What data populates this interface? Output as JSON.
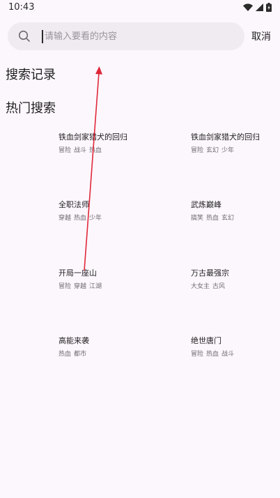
{
  "status_bar": {
    "time": "10:43",
    "icons": [
      "wifi-icon",
      "signal-icon",
      "battery-icon"
    ]
  },
  "search": {
    "placeholder": "请输入要看的内容",
    "value": "",
    "cancel_label": "取消"
  },
  "sections": {
    "history_title": "搜索记录",
    "hot_title": "热门搜索"
  },
  "hot_items": [
    {
      "title": "铁血剑家猎犬的回归",
      "tags": [
        "冒险",
        "战斗",
        "热血"
      ]
    },
    {
      "title": "铁血剑家猎犬的回归",
      "tags": [
        "冒险",
        "玄幻",
        "少年"
      ]
    },
    {
      "title": "全职法师",
      "tags": [
        "穿越",
        "热血",
        "少年"
      ]
    },
    {
      "title": "武炼巅峰",
      "tags": [
        "搞笑",
        "热血",
        "玄幻"
      ]
    },
    {
      "title": "开局一座山",
      "tags": [
        "冒险",
        "穿越",
        "江湖"
      ]
    },
    {
      "title": "万古最强宗",
      "tags": [
        "大女主",
        "古风"
      ]
    },
    {
      "title": "高能来袭",
      "tags": [
        "热血",
        "都市"
      ]
    },
    {
      "title": "绝世唐门",
      "tags": [
        "冒险",
        "热血",
        "战斗"
      ]
    }
  ],
  "colors": {
    "background": "#fcf7fd",
    "search_box": "#efebf0",
    "annotation_arrow": "#e0283a"
  }
}
